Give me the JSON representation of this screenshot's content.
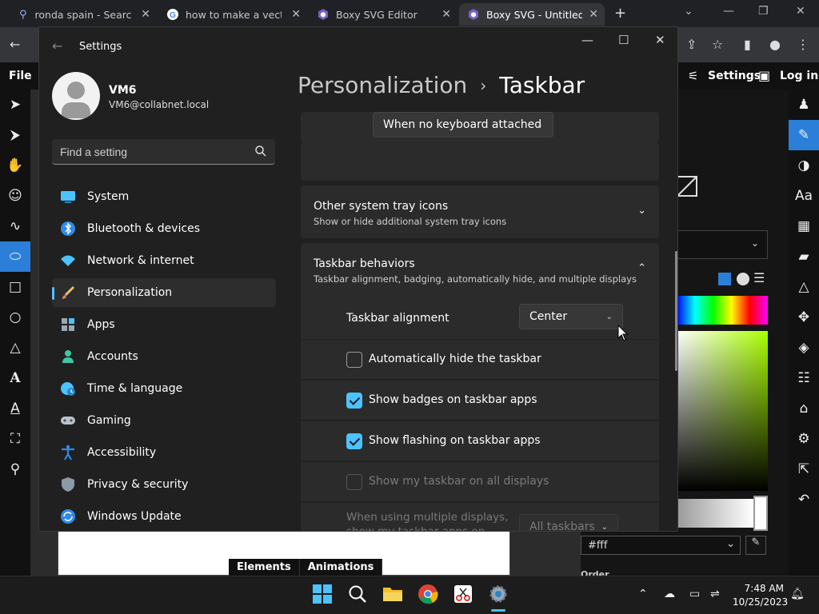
{
  "browser": {
    "tabs": [
      {
        "title": "ronda spain - Search"
      },
      {
        "title": "how to make a vector i"
      },
      {
        "title": "Boxy SVG Editor"
      },
      {
        "title": "Boxy SVG - Untitled [E"
      }
    ]
  },
  "boxy": {
    "menu_file": "File",
    "settings_label": "Settings",
    "login_label": "Log in",
    "bottom_tabs": [
      "Elements",
      "Animations"
    ],
    "color_value": "#fff",
    "order_label": "Order"
  },
  "settings": {
    "window_title": "Settings",
    "user": {
      "name": "VM6",
      "email": "VM6@collabnet.local"
    },
    "search": {
      "placeholder": "Find a setting"
    },
    "nav": [
      {
        "label": "System",
        "icon": "monitor-icon"
      },
      {
        "label": "Bluetooth & devices",
        "icon": "bluetooth-icon"
      },
      {
        "label": "Network & internet",
        "icon": "wifi-icon"
      },
      {
        "label": "Personalization",
        "icon": "brush-icon"
      },
      {
        "label": "Apps",
        "icon": "apps-icon"
      },
      {
        "label": "Accounts",
        "icon": "person-icon"
      },
      {
        "label": "Time & language",
        "icon": "globe-clock-icon"
      },
      {
        "label": "Gaming",
        "icon": "gamepad-icon"
      },
      {
        "label": "Accessibility",
        "icon": "accessibility-icon"
      },
      {
        "label": "Privacy & security",
        "icon": "shield-icon"
      },
      {
        "label": "Windows Update",
        "icon": "update-icon"
      }
    ],
    "breadcrumb": {
      "parent": "Personalization",
      "current": "Taskbar"
    },
    "top_dropdown": "When no keyboard attached",
    "tray_icons": {
      "title": "Other system tray icons",
      "sub": "Show or hide additional system tray icons"
    },
    "behaviors": {
      "title": "Taskbar behaviors",
      "sub": "Taskbar alignment, badging, automatically hide, and multiple displays",
      "alignment_label": "Taskbar alignment",
      "alignment_value": "Center",
      "checks": [
        {
          "label": "Automatically hide the taskbar",
          "checked": false
        },
        {
          "label": "Show badges on taskbar apps",
          "checked": true
        },
        {
          "label": "Show flashing on taskbar apps",
          "checked": true
        },
        {
          "label": "Show my taskbar on all displays",
          "checked": false,
          "disabled": true
        }
      ],
      "multi_label_1": "When using multiple displays,",
      "multi_label_2": "show my taskbar apps on",
      "multi_value": "All taskbars"
    }
  },
  "taskbar": {
    "time": "7:48 AM",
    "date": "10/25/2023"
  }
}
